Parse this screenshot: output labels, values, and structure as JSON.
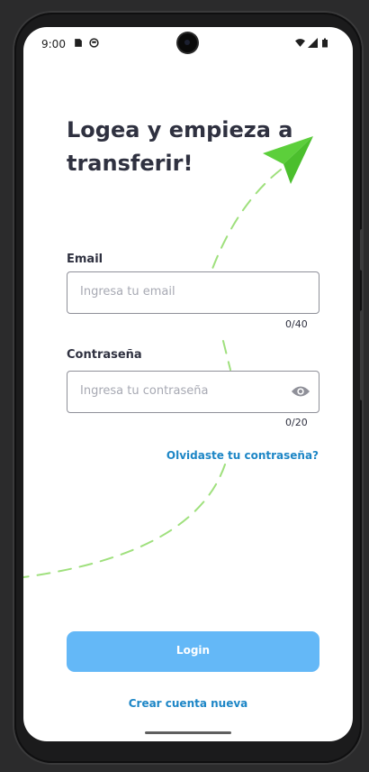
{
  "status_bar": {
    "time": "9:00",
    "left_icons": [
      "sim-card-icon",
      "smiley-icon"
    ],
    "right_icons": [
      "wifi-icon",
      "signal-icon",
      "battery-icon"
    ]
  },
  "header": {
    "title": "Logea y empieza a transferir!",
    "decoration_icon": "paper-plane-icon",
    "accent_color": "#5ccf3b"
  },
  "form": {
    "email": {
      "label": "Email",
      "placeholder": "Ingresa tu email",
      "value": "",
      "counter": "0/40"
    },
    "password": {
      "label": "Contraseña",
      "placeholder": "Ingresa tu contraseña",
      "value": "",
      "counter": "0/20",
      "toggle_icon": "eye-icon"
    },
    "forgot_password_link": "Olvidaste tu contraseña?"
  },
  "actions": {
    "login_label": "Login",
    "login_color": "#64b8f7",
    "create_account_link": "Crear cuenta nueva",
    "link_color": "#1d86c6"
  }
}
